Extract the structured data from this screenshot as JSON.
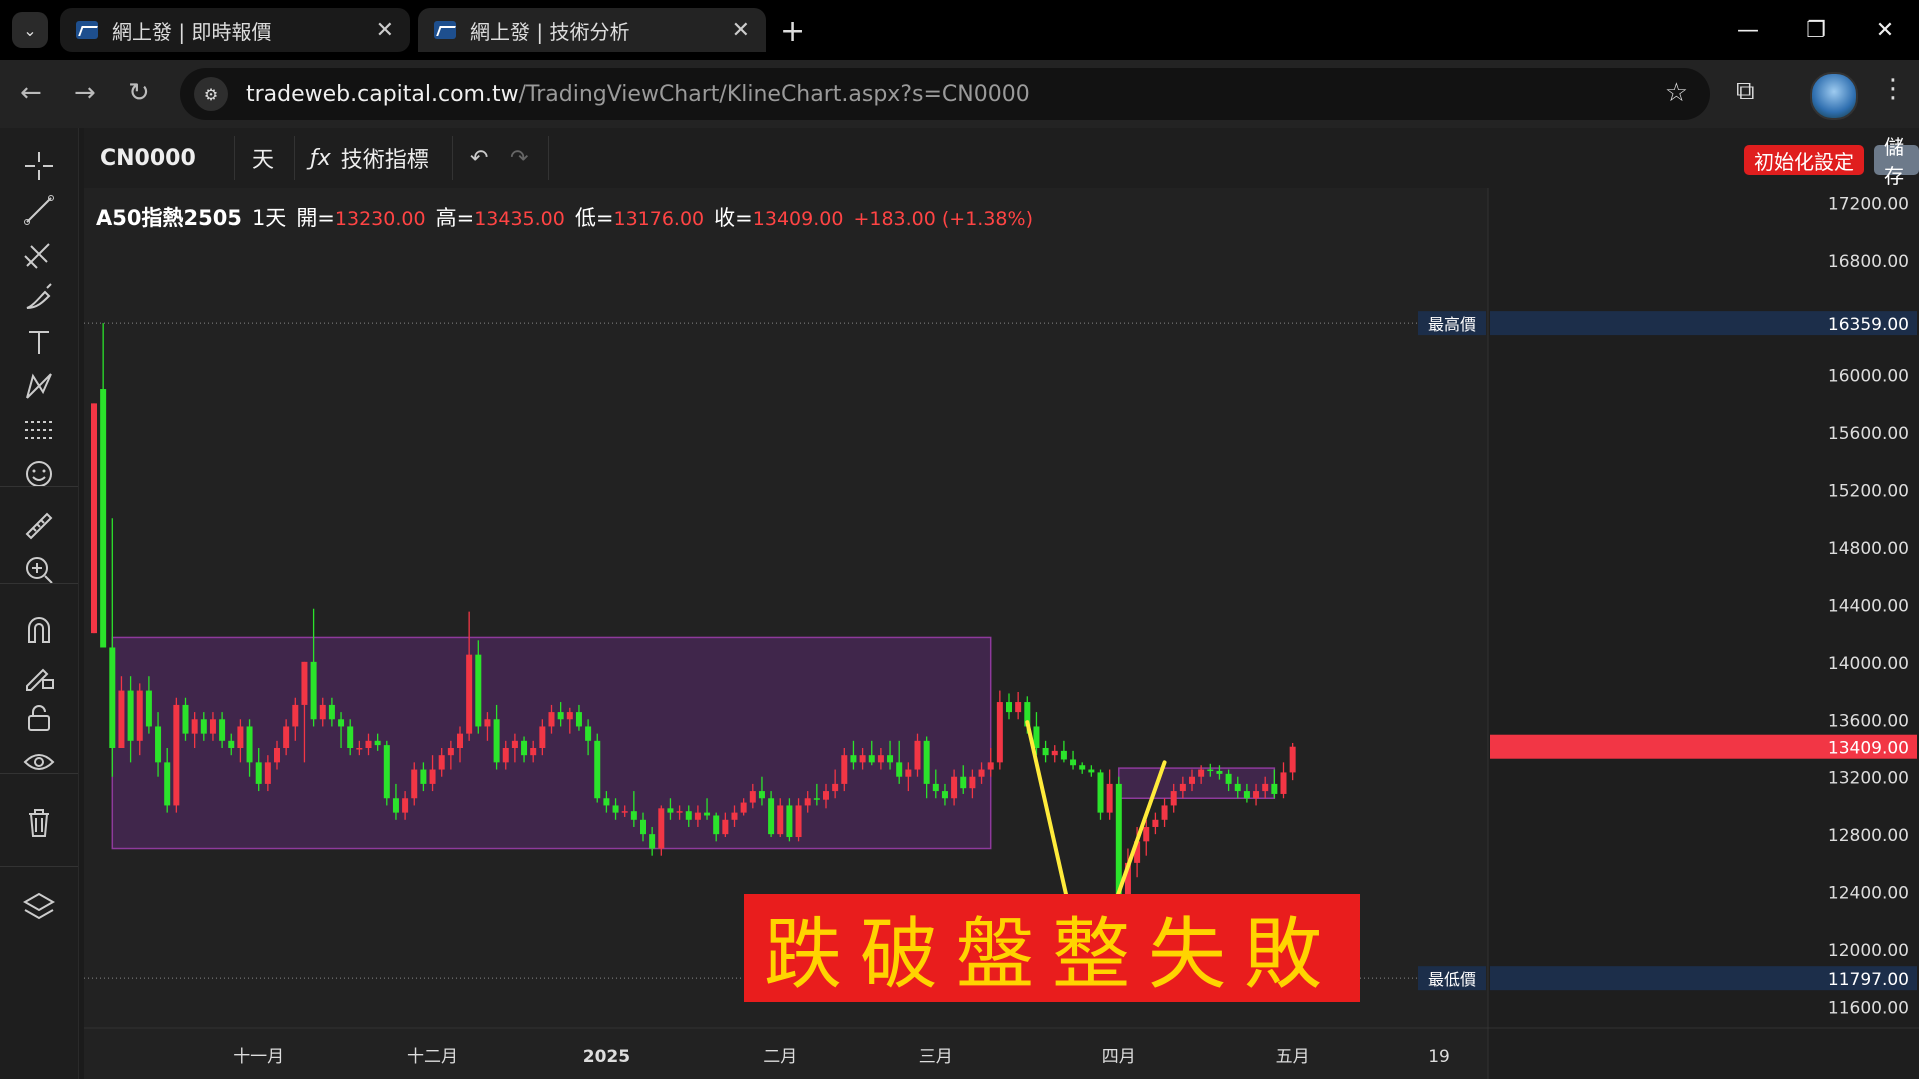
{
  "browser": {
    "tabs": [
      {
        "title": "網上發 | 即時報價",
        "active": false
      },
      {
        "title": "網上發 | 技術分析",
        "active": true
      }
    ],
    "url_host": "tradeweb.capital.com.tw",
    "url_path": "/TradingViewChart/KlineChart.aspx?s=CN0000"
  },
  "toolbar": {
    "symbol": "CN0000",
    "interval": "天",
    "indicators_label": "技術指標",
    "reset_label": "初始化設定",
    "save_label": "儲存"
  },
  "legend": {
    "name": "A50指熱2505",
    "interval": "1天",
    "open_key": "開=",
    "open": "13230.00",
    "high_key": "高=",
    "high": "13435.00",
    "low_key": "低=",
    "low": "13176.00",
    "close_key": "收=",
    "close": "13409.00",
    "change": "+183.00 (+1.38%)"
  },
  "banner_text": "跌破盤整失敗",
  "price_labels": {
    "max_label": "最高價",
    "max_value": "16359.00",
    "min_label": "最低價",
    "min_value": "11797.00",
    "last_value": "13409.00"
  },
  "colors": {
    "up": "#f23645",
    "down": "#2be32b",
    "box": "#8e3a9c",
    "trend": "#ffeb3b"
  },
  "chart_data": {
    "type": "candlestick",
    "ylim": [
      11450,
      17300
    ],
    "y_ticks": [
      "17200.00",
      "16800.00",
      "16000.00",
      "15600.00",
      "15200.00",
      "14800.00",
      "14400.00",
      "14000.00",
      "13600.00",
      "13200.00",
      "12800.00",
      "12400.00",
      "12000.00",
      "11600.00"
    ],
    "x_ticks": [
      "十一月",
      "十二月",
      "2025",
      "二月",
      "三月",
      "四月",
      "五月",
      "19"
    ],
    "ohlc": [
      [
        14200,
        15800,
        14200,
        15800
      ],
      [
        15900,
        16359,
        14100,
        14100
      ],
      [
        14100,
        15000,
        13200,
        13400
      ],
      [
        13400,
        13900,
        13400,
        13800
      ],
      [
        13800,
        13900,
        13300,
        13450
      ],
      [
        13450,
        13850,
        13350,
        13800
      ],
      [
        13800,
        13900,
        13500,
        13550
      ],
      [
        13550,
        13650,
        13200,
        13300
      ],
      [
        13300,
        13400,
        12950,
        13000
      ],
      [
        13000,
        13750,
        12950,
        13700
      ],
      [
        13700,
        13750,
        13450,
        13500
      ],
      [
        13500,
        13650,
        13400,
        13600
      ],
      [
        13600,
        13650,
        13450,
        13500
      ],
      [
        13500,
        13650,
        13450,
        13600
      ],
      [
        13600,
        13650,
        13400,
        13450
      ],
      [
        13450,
        13500,
        13350,
        13400
      ],
      [
        13400,
        13600,
        13300,
        13550
      ],
      [
        13550,
        13600,
        13200,
        13300
      ],
      [
        13300,
        13400,
        13100,
        13150
      ],
      [
        13150,
        13350,
        13100,
        13300
      ],
      [
        13300,
        13450,
        13250,
        13400
      ],
      [
        13400,
        13600,
        13350,
        13550
      ],
      [
        13550,
        13750,
        13450,
        13700
      ],
      [
        13700,
        14000,
        13300,
        14000
      ],
      [
        14000,
        14370,
        13550,
        13600
      ],
      [
        13600,
        13750,
        13550,
        13700
      ],
      [
        13700,
        13750,
        13550,
        13600
      ],
      [
        13600,
        13650,
        13400,
        13550
      ],
      [
        13550,
        13600,
        13350,
        13400
      ],
      [
        13400,
        13450,
        13350,
        13400
      ],
      [
        13400,
        13500,
        13350,
        13450
      ],
      [
        13450,
        13500,
        13380,
        13420
      ],
      [
        13420,
        13450,
        13000,
        13050
      ],
      [
        13050,
        13150,
        12900,
        12950
      ],
      [
        12950,
        13100,
        12900,
        13050
      ],
      [
        13050,
        13300,
        13000,
        13250
      ],
      [
        13250,
        13300,
        13100,
        13150
      ],
      [
        13150,
        13350,
        13100,
        13250
      ],
      [
        13250,
        13400,
        13200,
        13350
      ],
      [
        13350,
        13450,
        13250,
        13400
      ],
      [
        13400,
        13550,
        13300,
        13500
      ],
      [
        13500,
        14350,
        13450,
        14050
      ],
      [
        14050,
        14150,
        13500,
        13550
      ],
      [
        13550,
        13650,
        13450,
        13600
      ],
      [
        13600,
        13700,
        13250,
        13300
      ],
      [
        13300,
        13450,
        13250,
        13400
      ],
      [
        13400,
        13500,
        13300,
        13450
      ],
      [
        13450,
        13480,
        13300,
        13350
      ],
      [
        13350,
        13450,
        13300,
        13400
      ],
      [
        13400,
        13600,
        13350,
        13550
      ],
      [
        13550,
        13700,
        13500,
        13650
      ],
      [
        13650,
        13720,
        13550,
        13600
      ],
      [
        13600,
        13680,
        13500,
        13650
      ],
      [
        13650,
        13700,
        13520,
        13550
      ],
      [
        13550,
        13600,
        13350,
        13450
      ],
      [
        13450,
        13500,
        13020,
        13050
      ],
      [
        13050,
        13100,
        12950,
        13000
      ],
      [
        13000,
        13050,
        12900,
        12950
      ],
      [
        12950,
        13000,
        12920,
        12960
      ],
      [
        12960,
        13100,
        12850,
        12900
      ],
      [
        12900,
        12950,
        12750,
        12800
      ],
      [
        12800,
        12850,
        12650,
        12700
      ],
      [
        12700,
        13000,
        12650,
        12980
      ],
      [
        12980,
        13050,
        12900,
        12950
      ],
      [
        12950,
        13000,
        12900,
        12960
      ],
      [
        12960,
        13000,
        12850,
        12900
      ],
      [
        12900,
        13000,
        12850,
        12950
      ],
      [
        12950,
        13050,
        12900,
        12930
      ],
      [
        12930,
        12950,
        12750,
        12800
      ],
      [
        12800,
        12950,
        12780,
        12900
      ],
      [
        12900,
        13000,
        12850,
        12950
      ],
      [
        12950,
        13050,
        12930,
        13020
      ],
      [
        13020,
        13150,
        12980,
        13100
      ],
      [
        13100,
        13200,
        13000,
        13050
      ],
      [
        13050,
        13100,
        12780,
        12800
      ],
      [
        12800,
        13050,
        12780,
        13000
      ],
      [
        13000,
        13050,
        12750,
        12780
      ],
      [
        12780,
        13050,
        12750,
        13000
      ],
      [
        13000,
        13100,
        12950,
        13050
      ],
      [
        13050,
        13150,
        13000,
        13040
      ],
      [
        13040,
        13150,
        12980,
        13100
      ],
      [
        13100,
        13250,
        13050,
        13150
      ],
      [
        13150,
        13400,
        13100,
        13350
      ],
      [
        13350,
        13450,
        13250,
        13300
      ],
      [
        13300,
        13400,
        13250,
        13350
      ],
      [
        13350,
        13450,
        13280,
        13300
      ],
      [
        13300,
        13400,
        13250,
        13350
      ],
      [
        13350,
        13450,
        13250,
        13300
      ],
      [
        13300,
        13450,
        13150,
        13200
      ],
      [
        13200,
        13300,
        13100,
        13250
      ],
      [
        13250,
        13500,
        13200,
        13450
      ],
      [
        13450,
        13480,
        13050,
        13150
      ],
      [
        13150,
        13250,
        13050,
        13100
      ],
      [
        13100,
        13150,
        13000,
        13050
      ],
      [
        13050,
        13250,
        13000,
        13200
      ],
      [
        13200,
        13280,
        13080,
        13120
      ],
      [
        13120,
        13250,
        13050,
        13200
      ],
      [
        13200,
        13300,
        13150,
        13250
      ],
      [
        13250,
        13400,
        13200,
        13300
      ],
      [
        13300,
        13800,
        13250,
        13720
      ],
      [
        13720,
        13780,
        13600,
        13650
      ],
      [
        13650,
        13790,
        13600,
        13720
      ],
      [
        13720,
        13760,
        13500,
        13550
      ],
      [
        13550,
        13650,
        13350,
        13400
      ],
      [
        13400,
        13450,
        13300,
        13350
      ],
      [
        13350,
        13420,
        13300,
        13380
      ],
      [
        13380,
        13450,
        13300,
        13320
      ],
      [
        13320,
        13380,
        13250,
        13280
      ],
      [
        13280,
        13300,
        13220,
        13250
      ],
      [
        13250,
        13280,
        13200,
        13230
      ],
      [
        13230,
        13250,
        12900,
        12950
      ],
      [
        12950,
        13250,
        12900,
        13150
      ],
      [
        13150,
        13200,
        11797,
        11900
      ],
      [
        11900,
        12700,
        11850,
        12600
      ],
      [
        12600,
        12850,
        12500,
        12750
      ],
      [
        12750,
        12900,
        12650,
        12850
      ],
      [
        12850,
        12950,
        12800,
        12900
      ],
      [
        12900,
        13050,
        12850,
        13000
      ],
      [
        13000,
        13150,
        12950,
        13100
      ],
      [
        13100,
        13200,
        13050,
        13150
      ],
      [
        13150,
        13250,
        13100,
        13200
      ],
      [
        13200,
        13280,
        13150,
        13250
      ],
      [
        13250,
        13290,
        13200,
        13240
      ],
      [
        13240,
        13280,
        13180,
        13220
      ],
      [
        13220,
        13250,
        13100,
        13150
      ],
      [
        13150,
        13200,
        13050,
        13100
      ],
      [
        13100,
        13150,
        13020,
        13050
      ],
      [
        13050,
        13150,
        13000,
        13100
      ],
      [
        13100,
        13200,
        13050,
        13150
      ],
      [
        13150,
        13250,
        13050,
        13080
      ],
      [
        13080,
        13300,
        13050,
        13230
      ],
      [
        13230,
        13435,
        13176,
        13409
      ]
    ],
    "boxes": [
      {
        "x0": 2,
        "x1": 98,
        "y0": 12700,
        "y1": 14170
      },
      {
        "x0": 112,
        "x1": 129,
        "y0": 13050,
        "y1": 13260
      }
    ],
    "trend_lines": [
      {
        "x0": 102,
        "y0": 13580,
        "x1": 108,
        "y1": 11880
      },
      {
        "x0": 109,
        "y0": 11850,
        "x1": 117,
        "y1": 13300
      }
    ]
  }
}
